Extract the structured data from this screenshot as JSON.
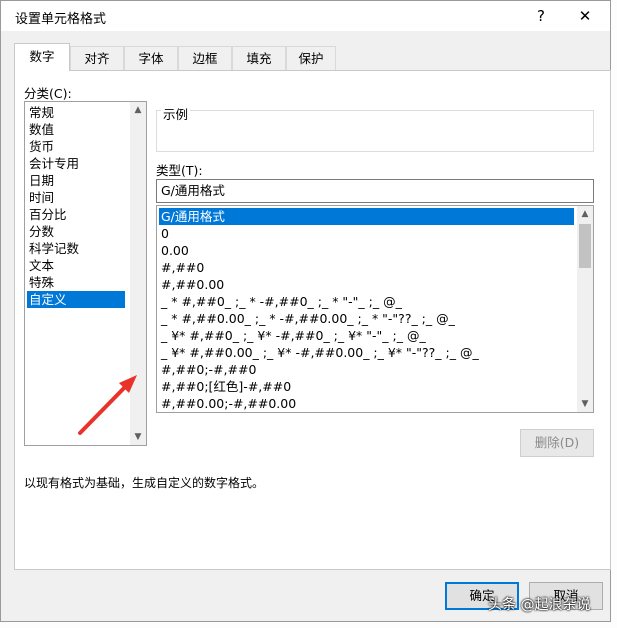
{
  "dialog": {
    "title": "设置单元格格式",
    "help_icon": "?",
    "close_icon": "✕"
  },
  "tabs": [
    {
      "label": "数字",
      "active": true
    },
    {
      "label": "对齐"
    },
    {
      "label": "字体"
    },
    {
      "label": "边框"
    },
    {
      "label": "填充"
    },
    {
      "label": "保护"
    }
  ],
  "category": {
    "label": "分类(C):",
    "items": [
      "常规",
      "数值",
      "货币",
      "会计专用",
      "日期",
      "时间",
      "百分比",
      "分数",
      "科学记数",
      "文本",
      "特殊",
      "自定义"
    ],
    "selected": "自定义"
  },
  "sample": {
    "label": "示例"
  },
  "type": {
    "label": "类型(T):",
    "value": "G/通用格式",
    "items": [
      "G/通用格式",
      "0",
      "0.00",
      "#,##0",
      "#,##0.00",
      "_ * #,##0_ ;_ * -#,##0_ ;_ * \"-\"_ ;_ @_",
      "_ * #,##0.00_ ;_ * -#,##0.00_ ;_ * \"-\"??_ ;_ @_",
      "_ ¥* #,##0_ ;_ ¥* -#,##0_ ;_ ¥* \"-\"_ ;_ @_",
      "_ ¥* #,##0.00_ ;_ ¥* -#,##0.00_ ;_ ¥* \"-\"??_ ;_ @_",
      "#,##0;-#,##0",
      "#,##0;[红色]-#,##0",
      "#,##0.00;-#,##0.00"
    ],
    "selected": "G/通用格式"
  },
  "buttons": {
    "delete": "删除(D)",
    "ok": "确定",
    "cancel": "取消"
  },
  "description": "以现有格式为基础，生成自定义的数字格式。",
  "watermark": "头条 @起浪杂说",
  "annotation": {
    "arrow_color": "#e8322a"
  },
  "colors": {
    "selection": "#0078d7"
  }
}
